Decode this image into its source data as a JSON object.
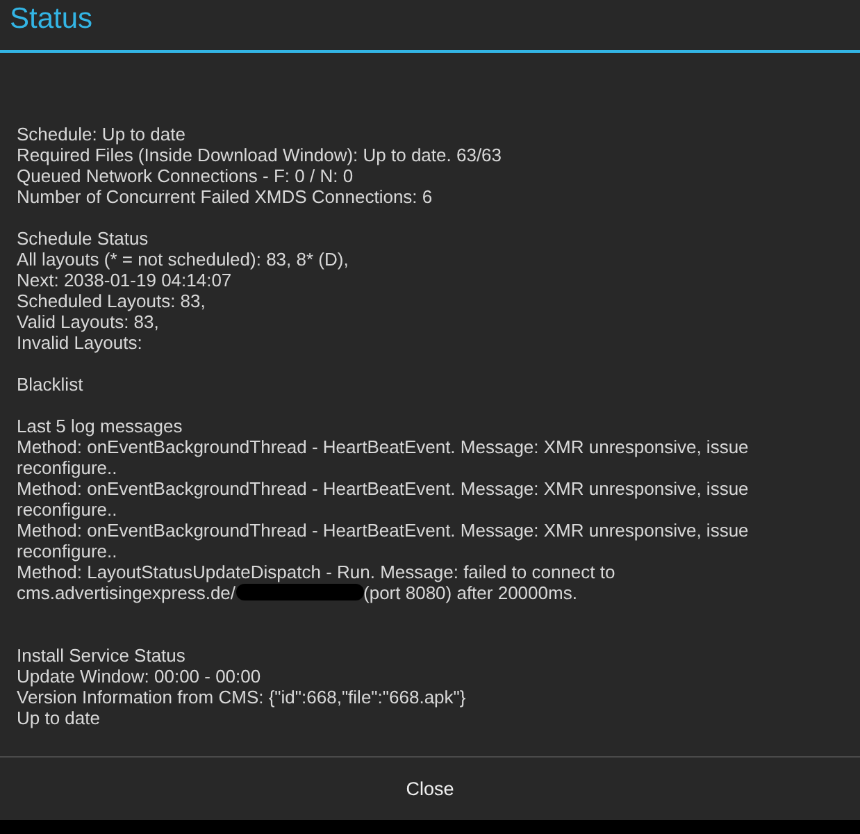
{
  "dialog": {
    "title": "Status",
    "lines": [
      {
        "kind": "text",
        "text": "Schedule: Up to date"
      },
      {
        "kind": "text",
        "text": "Required Files (Inside Download Window): Up to date. 63/63"
      },
      {
        "kind": "text",
        "text": "Queued Network Connections - F: 0 / N: 0"
      },
      {
        "kind": "text",
        "text": "Number of Concurrent Failed XMDS Connections: 6"
      },
      {
        "kind": "gap"
      },
      {
        "kind": "text",
        "text": "Schedule Status"
      },
      {
        "kind": "text",
        "text": "All layouts (* = not scheduled): 83, 8* (D),"
      },
      {
        "kind": "text",
        "text": "Next: 2038-01-19 04:14:07"
      },
      {
        "kind": "text",
        "text": "Scheduled Layouts: 83,"
      },
      {
        "kind": "text",
        "text": "Valid Layouts: 83,"
      },
      {
        "kind": "text",
        "text": "Invalid Layouts:"
      },
      {
        "kind": "gap"
      },
      {
        "kind": "text",
        "text": "Blacklist"
      },
      {
        "kind": "gap"
      },
      {
        "kind": "text",
        "text": "Last 5 log messages"
      },
      {
        "kind": "text",
        "text": "Method: onEventBackgroundThread - HeartBeatEvent. Message: XMR unresponsive, issue reconfigure.."
      },
      {
        "kind": "text",
        "text": "Method: onEventBackgroundThread - HeartBeatEvent. Message: XMR unresponsive, issue reconfigure.."
      },
      {
        "kind": "text",
        "text": "Method: onEventBackgroundThread - HeartBeatEvent. Message: XMR unresponsive, issue reconfigure.."
      },
      {
        "kind": "text",
        "text": "Method: LayoutStatusUpdateDispatch - Run. Message: failed to connect to"
      },
      {
        "kind": "redacted",
        "before": "cms.advertisingexpress.de/",
        "after": "(port 8080) after 20000ms."
      },
      {
        "kind": "gap"
      },
      {
        "kind": "gap"
      },
      {
        "kind": "text",
        "text": "Install Service Status"
      },
      {
        "kind": "text",
        "text": "Update Window: 00:00 - 00:00"
      },
      {
        "kind": "text",
        "text": "Version Information from CMS: {\"id\":668,\"file\":\"668.apk\"}"
      },
      {
        "kind": "text",
        "text": "Up to date"
      }
    ],
    "button": "Close"
  }
}
